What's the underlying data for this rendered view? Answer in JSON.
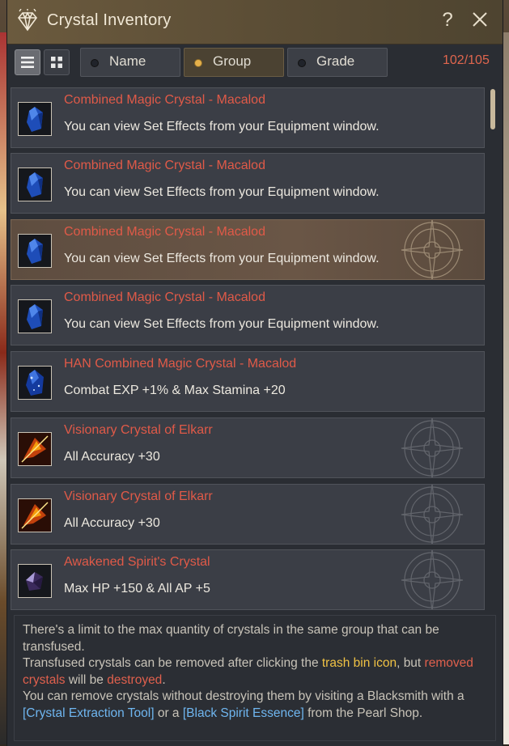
{
  "window": {
    "title": "Crystal Inventory",
    "help_label": "?"
  },
  "toolbar": {
    "sort_name": "Name",
    "sort_group": "Group",
    "sort_grade": "Grade",
    "selected_sort": "Group",
    "count": "102/105"
  },
  "items": [
    {
      "name": "Combined Magic Crystal - Macalod",
      "desc": "You can view Set Effects from your Equipment window.",
      "icon": "blue-crystal-icon"
    },
    {
      "name": "Combined Magic Crystal - Macalod",
      "desc": "You can view Set Effects from your Equipment window.",
      "icon": "blue-crystal-icon"
    },
    {
      "name": "Combined Magic Crystal - Macalod",
      "desc": "You can view Set Effects from your Equipment window.",
      "icon": "blue-crystal-icon",
      "selected": true
    },
    {
      "name": "Combined Magic Crystal - Macalod",
      "desc": "You can view Set Effects from your Equipment window.",
      "icon": "blue-crystal-icon"
    },
    {
      "name": "HAN Combined Magic Crystal - Macalod",
      "desc": "Combat EXP +1% & Max Stamina +20",
      "icon": "han-crystal-icon"
    },
    {
      "name": "Visionary Crystal of Elkarr",
      "desc": "All Accuracy +30",
      "icon": "fire-crystal-icon"
    },
    {
      "name": "Visionary Crystal of Elkarr",
      "desc": "All Accuracy +30",
      "icon": "fire-crystal-icon"
    },
    {
      "name": "Awakened Spirit's Crystal",
      "desc": "Max HP +150 & All AP +5",
      "icon": "purple-crystal-icon"
    }
  ],
  "info": {
    "line1": "There's a limit to the max quantity of crystals in the same group that can be transfused.",
    "line2a": "Transfused crystals can be removed after clicking the ",
    "line2b": "trash bin icon",
    "line2c": ", but ",
    "line2d": "removed crystals",
    "line2e": " will be ",
    "line2f": "destroyed",
    "line2g": ".",
    "line3a": "You can remove crystals without destroying them by visiting a Blacksmith with a ",
    "line3b": "[Crystal Extraction Tool]",
    "line3c": " or a ",
    "line3d": "[Black Spirit Essence]",
    "line3e": " from the Pearl Shop."
  },
  "colors": {
    "item_name": "#e05a48",
    "count": "#e0664e",
    "highlight_yellow": "#f0c244",
    "highlight_red": "#e0604d",
    "highlight_blue": "#6fb6f0"
  }
}
